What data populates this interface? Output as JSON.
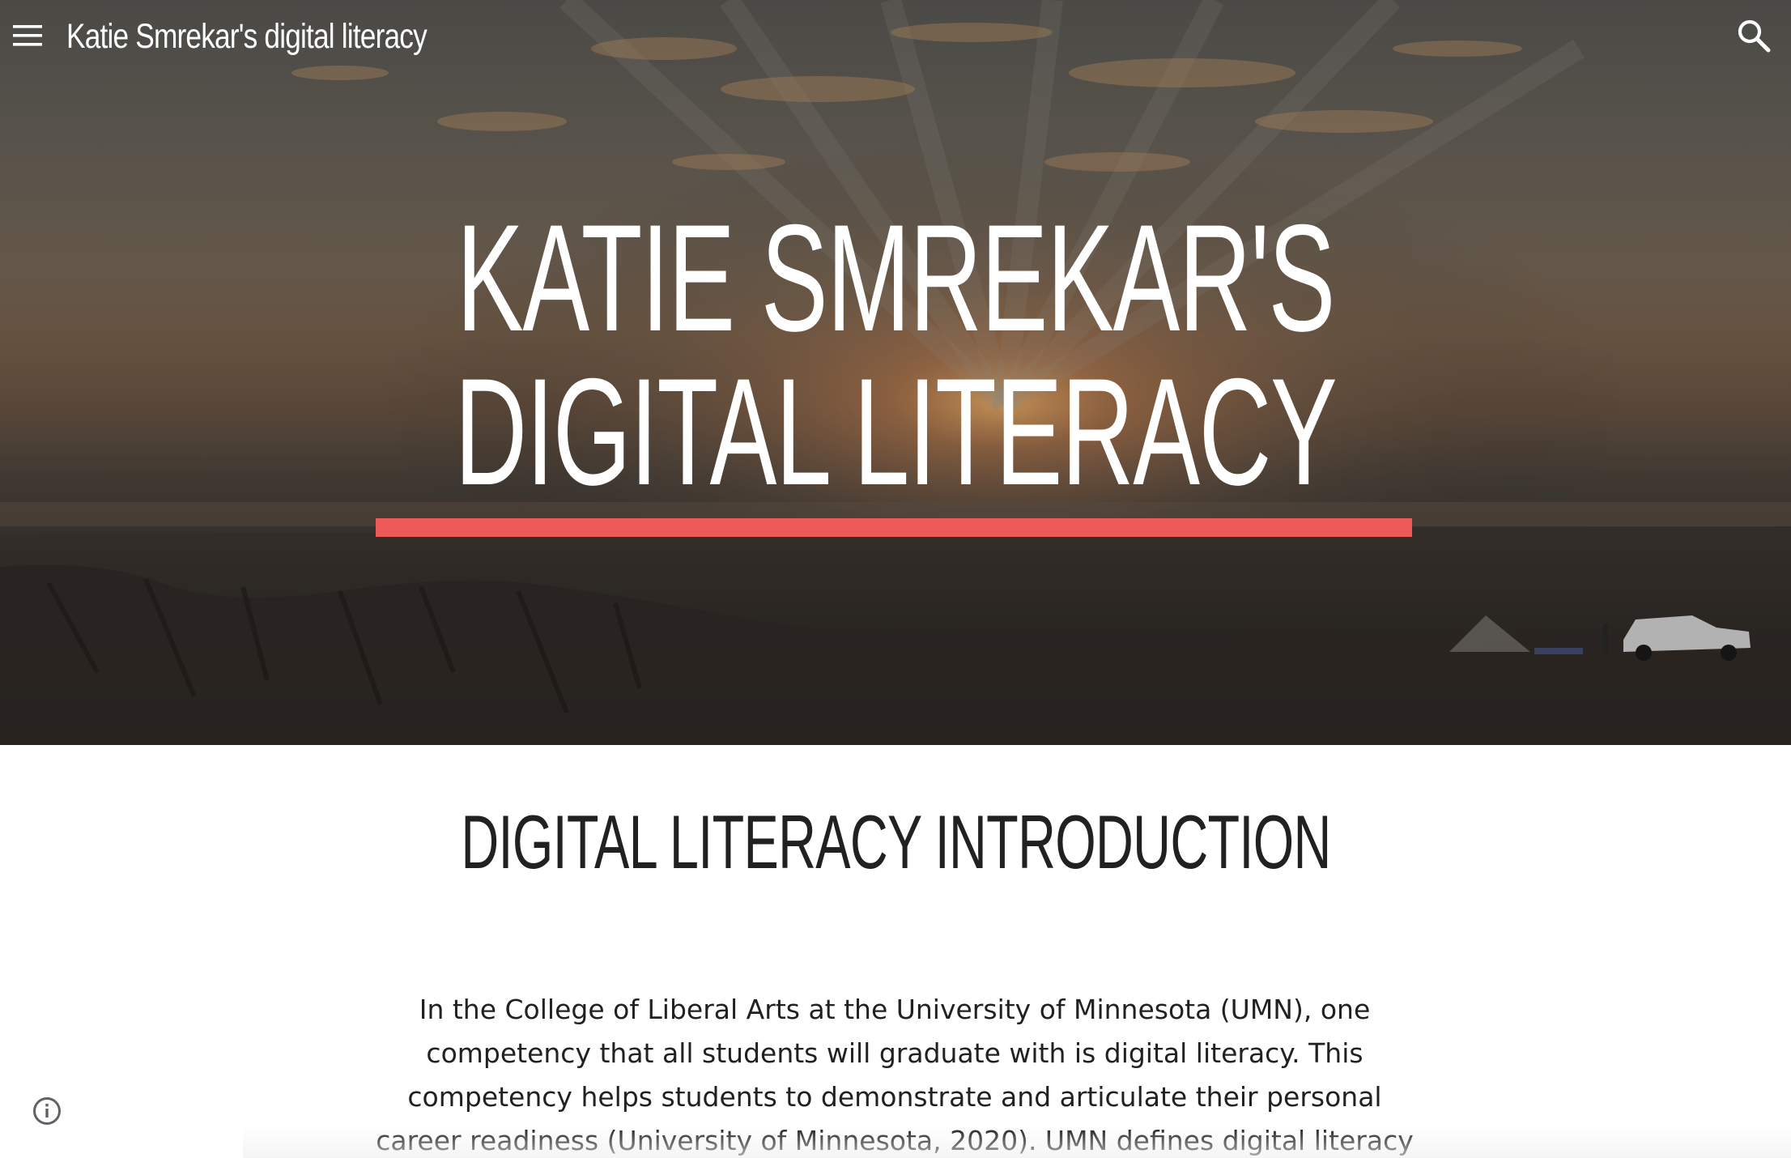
{
  "header": {
    "site_title": "Katie Smrekar's digital literacy",
    "menu_icon": "hamburger-menu-icon",
    "search_icon": "search-icon"
  },
  "hero": {
    "title_line1": "KATIE SMREKAR'S",
    "title_line2": "DIGITAL LITERACY",
    "accent_color": "#ec5b57"
  },
  "main": {
    "section_heading": "DIGITAL LITERACY INTRODUCTION",
    "paragraph_lines": [
      "In the College of Liberal Arts at the University of Minnesota (UMN), one",
      "competency that all students will graduate with is digital literacy. This",
      "competency helps students to demonstrate and articulate their personal",
      "career readiness (University of Minnesota, 2020). UMN defines digital literacy"
    ]
  },
  "footer": {
    "info_icon": "info-icon"
  }
}
